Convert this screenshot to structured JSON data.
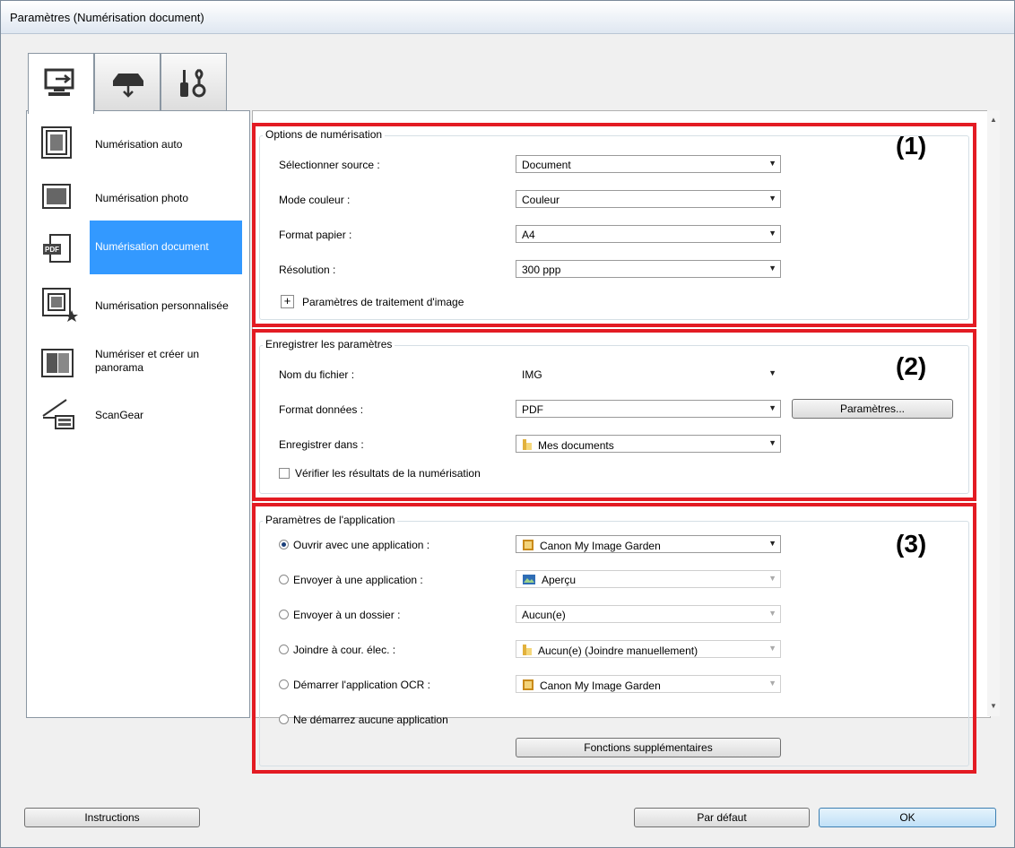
{
  "window": {
    "title": "Paramètres (Numérisation document)"
  },
  "tabs": [
    {
      "icon": "scan-from-computer-icon"
    },
    {
      "icon": "scan-from-panel-icon"
    },
    {
      "icon": "general-settings-icon"
    }
  ],
  "sidebar": {
    "items": [
      {
        "label": "Numérisation auto",
        "icon": "auto-scan-icon"
      },
      {
        "label": "Numérisation photo",
        "icon": "photo-scan-icon"
      },
      {
        "label": "Numérisation document",
        "icon": "pdf-document-icon",
        "selected": true
      },
      {
        "label": "Numérisation personnalisée",
        "icon": "custom-scan-icon"
      },
      {
        "label_line1": "Numériser et créer un",
        "label_line2": "panorama",
        "icon": "stitch-icon"
      },
      {
        "label": "ScanGear",
        "icon": "scangear-icon"
      }
    ]
  },
  "callouts": {
    "one": "(1)",
    "two": "(2)",
    "three": "(3)"
  },
  "scan_options": {
    "title": "Options de numérisation",
    "source_label": "Sélectionner source :",
    "source_value": "Document",
    "color_label": "Mode couleur :",
    "color_value": "Couleur",
    "paper_label": "Format papier :",
    "paper_value": "A4",
    "resolution_label": "Résolution :",
    "resolution_value": "300 ppp",
    "image_processing_label": "Paramètres de traitement d'image"
  },
  "save_settings": {
    "title": "Enregistrer les paramètres",
    "filename_label": "Nom du fichier :",
    "filename_value": "IMG",
    "format_label": "Format données :",
    "format_value": "PDF",
    "settings_button": "Paramètres...",
    "savein_label": "Enregistrer dans :",
    "savein_value": "Mes documents",
    "check_label": "Vérifier les résultats de la numérisation"
  },
  "app_settings": {
    "title": "Paramètres de l'application",
    "open_label": "Ouvrir avec une application :",
    "open_value": "Canon My Image Garden",
    "send_app_label": "Envoyer à une application :",
    "send_app_value": "Aperçu",
    "send_folder_label": "Envoyer à un dossier :",
    "send_folder_value": "Aucun(e)",
    "email_label": "Joindre à cour. élec. :",
    "email_value": "Aucun(e) (Joindre manuellement)",
    "ocr_label": "Démarrer l'application OCR :",
    "ocr_value": "Canon My Image Garden",
    "none_label": "Ne démarrez aucune application",
    "more_button": "Fonctions supplémentaires"
  },
  "footer": {
    "instructions": "Instructions",
    "defaults": "Par défaut",
    "ok": "OK"
  },
  "colors": {
    "accent": "#3399ff",
    "callout": "#e31b23"
  }
}
